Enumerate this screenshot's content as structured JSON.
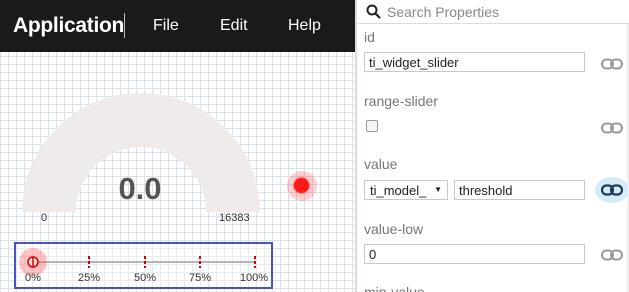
{
  "appbar": {
    "title": "Application",
    "menu": [
      "File",
      "Edit",
      "Help"
    ]
  },
  "gauge": {
    "value": "0.0",
    "min": "0",
    "max": "16383",
    "level": 0
  },
  "slider": {
    "labels": [
      "0%",
      "25%",
      "50%",
      "75%",
      "100%"
    ],
    "value": 0
  },
  "properties": {
    "search_placeholder": "Search Properties",
    "id_label": "id",
    "id_value": "ti_widget_slider",
    "range_slider_label": "range-slider",
    "range_slider_checked": false,
    "value_label": "value",
    "value_model": "ti_model_",
    "value_binding": "threshold",
    "value_low_label": "value-low",
    "value_low": "0",
    "min_value_label": "min-value"
  },
  "colors": {
    "appbar_bg": "#1a1a1a",
    "gauge_arc": "#efebea",
    "led": "#ff1a1a",
    "slider_border": "#4a52c4",
    "slider_tick": "#d10000"
  }
}
